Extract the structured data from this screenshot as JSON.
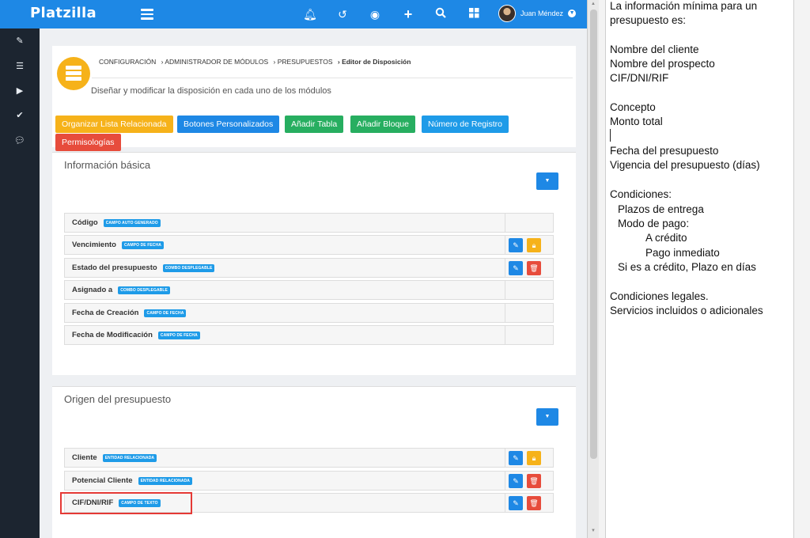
{
  "app": {
    "brand": "Platzilla",
    "user_name": "Juan Méndez"
  },
  "topbar_icons": [
    "bell-icon",
    "history-icon",
    "eye-icon",
    "plus-icon",
    "search-icon",
    "grid-icon"
  ],
  "sidebar_icons": [
    "edit-icon",
    "list-icon",
    "play-icon",
    "check-icon",
    "chat-icon"
  ],
  "breadcrumb": [
    "CONFIGURACIÓN",
    "› ADMINISTRADOR DE MÓDULOS",
    "› PRESUPUESTOS",
    "› Editor de Disposición"
  ],
  "description": "Diseñar y modificar la disposición en cada uno de los módulos",
  "buttons": [
    {
      "label": "Organizar Lista Relacionada",
      "color": "#f6b21a"
    },
    {
      "label": "Botones Personalizados",
      "color": "#1e88e5"
    },
    {
      "label": "Añadir Tabla",
      "color": "#27ae60"
    },
    {
      "label": "Añadir Bloque",
      "color": "#27ae60"
    },
    {
      "label": "Número de Registro",
      "color": "#1e9be8"
    },
    {
      "label": "Permisologías",
      "color": "#e74c3c"
    }
  ],
  "sections": [
    {
      "title": "Información básica",
      "fields": [
        {
          "label": "Código",
          "tag": "CAMPO AUTO GENERADO",
          "actions": []
        },
        {
          "label": "Vencimiento",
          "tag": "CAMPO DE FECHA",
          "actions": [
            "edit",
            "lock"
          ]
        },
        {
          "label": "Estado del presupuesto",
          "tag": "COMBO DESPLEGABLE",
          "actions": [
            "edit",
            "delete"
          ]
        },
        {
          "label": "Asignado a",
          "tag": "COMBO DESPLEGABLE",
          "actions": []
        },
        {
          "label": "Fecha de Creación",
          "tag": "CAMPO DE FECHA",
          "actions": []
        },
        {
          "label": "Fecha de Modificación",
          "tag": "CAMPO DE FECHA",
          "actions": []
        }
      ]
    },
    {
      "title": "Origen del presupuesto",
      "fields": [
        {
          "label": "Cliente",
          "tag": "ENTIDAD RELACIONADA",
          "actions": [
            "edit",
            "lock"
          ]
        },
        {
          "label": "Potencial Cliente",
          "tag": "ENTIDAD RELACIONADA",
          "actions": [
            "edit",
            "delete"
          ]
        },
        {
          "label": "CIF/DNI/RIF",
          "tag": "CAMPO DE TEXTO",
          "actions": [
            "edit",
            "delete"
          ]
        }
      ]
    }
  ],
  "notes": [
    "La información mínima para un",
    "presupuesto es:",
    "",
    "Nombre del cliente",
    "Nombre del prospecto",
    "CIF/DNI/RIF",
    "",
    "Concepto",
    "Monto total",
    "",
    "Fecha del presupuesto",
    "Vigencia del presupuesto (días)",
    "",
    "Condiciones:",
    "Plazos de entrega",
    "Modo de pago:",
    "A crédito",
    "Pago inmediato",
    "Si es a crédito, Plazo en días",
    "",
    "Condiciones legales.",
    "Servicios incluidos o adicionales"
  ]
}
